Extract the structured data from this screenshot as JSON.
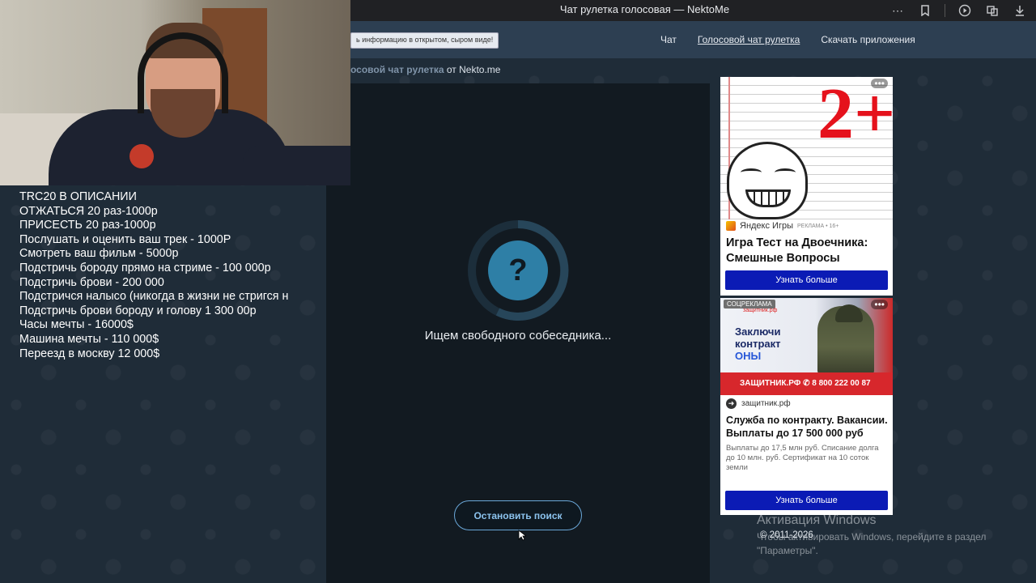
{
  "browser": {
    "title": "Чат рулетка голосовая — NektoMe"
  },
  "site": {
    "notice": "ь информацию в открытом, сыром виде!",
    "nav": [
      "Чат",
      "Голосовой чат рулетка",
      "Скачать приложения"
    ],
    "crumb_link": "осовой чат рулетка",
    "crumb_suffix": "от Nekto.me"
  },
  "chat": {
    "status_text": "Ищем свободного собеседника...",
    "stop_button": "Остановить поиск",
    "question_mark": "?"
  },
  "stream_overlay": {
    "lines": [
      "TRC20 В ОПИСАНИИ",
      "ОТЖАТЬСЯ 20 раз-1000р",
      "ПРИСЕСТЬ 20 раз-1000р",
      "Послушать и оценить ваш трек - 1000Р",
      "Смотреть ваш фильм - 5000р",
      "Подстричь бороду прямо на стриме - 100 000р",
      "Подстричь брови - 200 000",
      "Подстричся налысо (никогда в жизни не стригся н",
      "Подстричь брови бороду и голову 1 300 00р",
      "Часы мечты - 16000$",
      "Машина мечты - 110 000$",
      "Переезд в москву 12 000$"
    ]
  },
  "ads": [
    {
      "source": "Яндекс Игры",
      "tag": "РЕКЛАМА • 16+",
      "headline": "Игра Тест на Двоечника: Смешные Вопросы",
      "button": "Узнать больше",
      "more": "•••",
      "image_text": "2+"
    },
    {
      "badge": "СОЦРЕКЛАМА",
      "brand_small": "защитник.рф",
      "slogan_line1": "Заключи",
      "slogan_line2": "контракт",
      "slogan_line3": "ОНЫ",
      "bar_text": "ЗАЩИТНИК.РФ  ✆ 8 800 222 00 87",
      "source": "защитник.рф",
      "headline": "Служба по контракту. Вакансии. Выплаты до 17 500 000 руб",
      "description": "Выплаты до 17,5 млн руб. Списание долга до 10 млн. руб. Сертификат на 10 соток земли",
      "button": "Узнать больше",
      "more": "•••"
    }
  ],
  "footer": {
    "copyright": "© 2011-2026",
    "activation_title": "Активация Windows",
    "activation_text": "Чтобы активировать Windows, перейдите в раздел \"Параметры\"."
  }
}
